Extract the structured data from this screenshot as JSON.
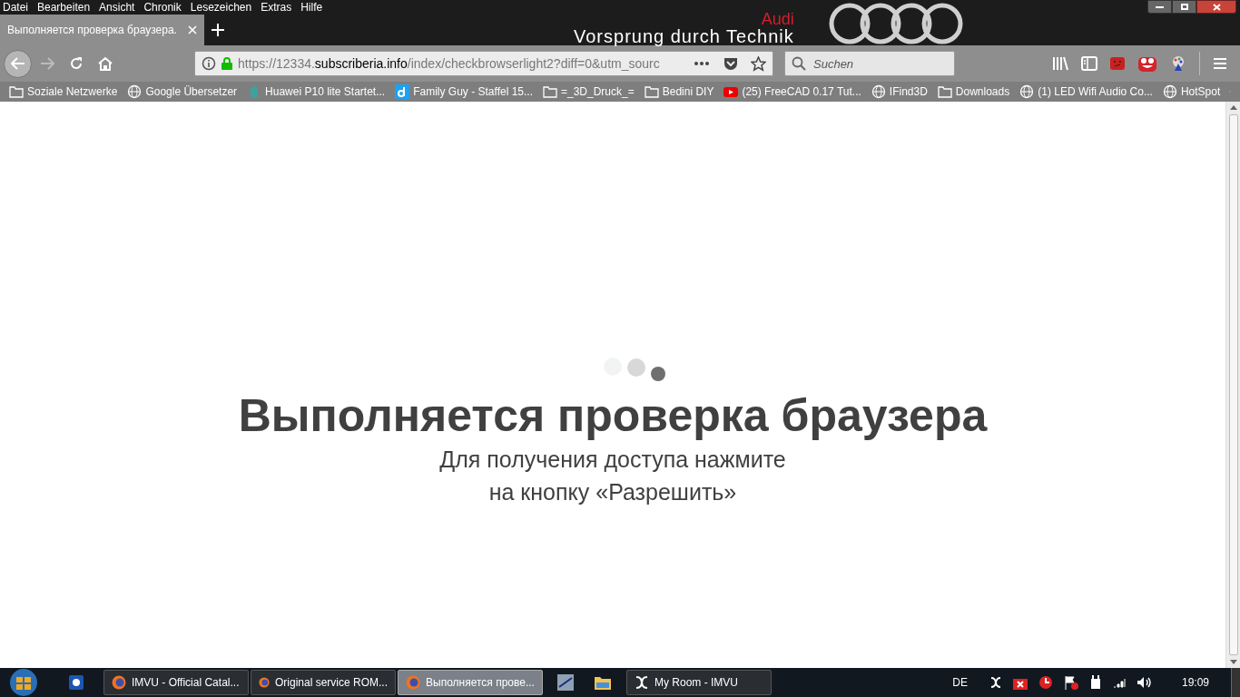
{
  "menu_bar": [
    "Datei",
    "Bearbeiten",
    "Ansicht",
    "Chronik",
    "Lesezeichen",
    "Extras",
    "Hilfe"
  ],
  "tabs": [
    {
      "label": "Выполняется проверка браузера.",
      "selected": true
    }
  ],
  "theme": {
    "brand": "Audi",
    "slogan": "Vorsprung durch Technik"
  },
  "address_bar": {
    "scheme": "https://12334.",
    "domain": "subscriberia.info",
    "path": "/index/checkbrowserlight2?diff=0&utm_sourc"
  },
  "search": {
    "placeholder": "Suchen"
  },
  "bookmarks": [
    {
      "label": "Soziale Netzwerke",
      "kind": "folder"
    },
    {
      "label": "Google Übersetzer",
      "kind": "globe"
    },
    {
      "label": "Huawei P10 lite Startet...",
      "kind": "android"
    },
    {
      "label": "Family Guy - Staffel 15...",
      "kind": "letter"
    },
    {
      "label": "=_3D_Druck_=",
      "kind": "folder"
    },
    {
      "label": "Bedini DIY",
      "kind": "folder"
    },
    {
      "label": "(25) FreeCAD 0.17 Tut...",
      "kind": "video"
    },
    {
      "label": "IFind3D",
      "kind": "globe"
    },
    {
      "label": "Downloads",
      "kind": "folder"
    },
    {
      "label": "(1) LED Wifi Audio Co...",
      "kind": "globe"
    },
    {
      "label": "HotSpot",
      "kind": "globe"
    }
  ],
  "page": {
    "heading": "Выполняется проверка браузера",
    "lines": [
      "Для получения доступа нажмите",
      "на кнопку «Разрешить»"
    ]
  },
  "taskbar": {
    "windows": [
      {
        "label": "IMVU - Official Catal...",
        "kind": "firefox",
        "selected": false
      },
      {
        "label": "Original service ROM...",
        "kind": "firefox",
        "selected": false
      },
      {
        "label": "Выполняется прове...",
        "kind": "firefox",
        "selected": true
      },
      {
        "label": "My Room - IMVU",
        "kind": "imvu",
        "selected": false
      }
    ],
    "language": "DE",
    "clock": "19:09"
  }
}
